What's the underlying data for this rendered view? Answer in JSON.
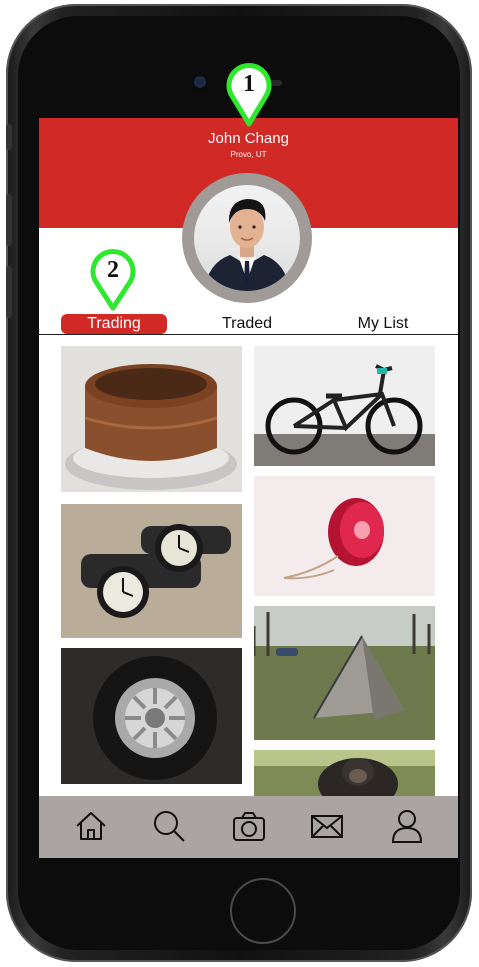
{
  "profile": {
    "name": "John Chang",
    "location": "Provo, UT"
  },
  "tabs": [
    {
      "label": "Trading",
      "active": true
    },
    {
      "label": "Traded",
      "active": false
    },
    {
      "label": "My List",
      "active": false
    }
  ],
  "annotations": [
    {
      "number": "1"
    },
    {
      "number": "2"
    }
  ],
  "items": [
    {
      "icon": "cake-photo"
    },
    {
      "icon": "bmx-bike-photo"
    },
    {
      "icon": "wristwatches-photo"
    },
    {
      "icon": "yoyo-photo"
    },
    {
      "icon": "tent-photo"
    },
    {
      "icon": "tire-photo"
    },
    {
      "icon": "gorilla-photo"
    }
  ],
  "nav": [
    {
      "icon": "home-icon"
    },
    {
      "icon": "search-icon"
    },
    {
      "icon": "camera-icon"
    },
    {
      "icon": "mail-icon"
    },
    {
      "icon": "profile-icon"
    }
  ],
  "colors": {
    "header": "#d12a26",
    "navbar": "#aaa4a2",
    "marker": "#2ee82e"
  }
}
